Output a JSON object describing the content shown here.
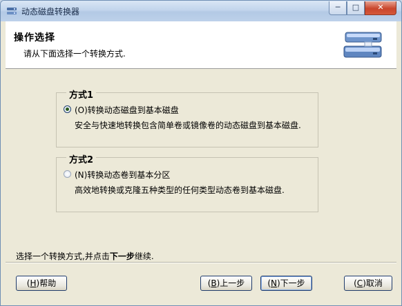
{
  "window": {
    "title": "动态磁盘转换器"
  },
  "title_controls": {
    "minimize": "─",
    "maximize": "□",
    "close": "✕"
  },
  "header": {
    "title": "操作选择",
    "subtitle": "请从下面选择一个转换方式."
  },
  "options": [
    {
      "legend": "方式1",
      "label": "(O)转换动态磁盘到基本磁盘",
      "description": "安全与快速地转换包含简单卷或镜像卷的动态磁盘到基本磁盘.",
      "selected": true
    },
    {
      "legend": "方式2",
      "label": "(N)转换动态卷到基本分区",
      "description": "高效地转换或克隆五种类型的任何类型动态卷到基本磁盘.",
      "selected": false
    }
  ],
  "hint": {
    "before": "选择一个转换方式,并点击",
    "bold": "下一步",
    "after": "继续."
  },
  "buttons": {
    "help_key": "H",
    "help_label": "帮助",
    "back_key": "B",
    "back_label": "上一步",
    "next_key": "N",
    "next_label": "下一步",
    "cancel_key": "C",
    "cancel_label": "取消"
  },
  "icons": {
    "app": "disk-converter-icon",
    "header": "hard-drives-icon"
  }
}
